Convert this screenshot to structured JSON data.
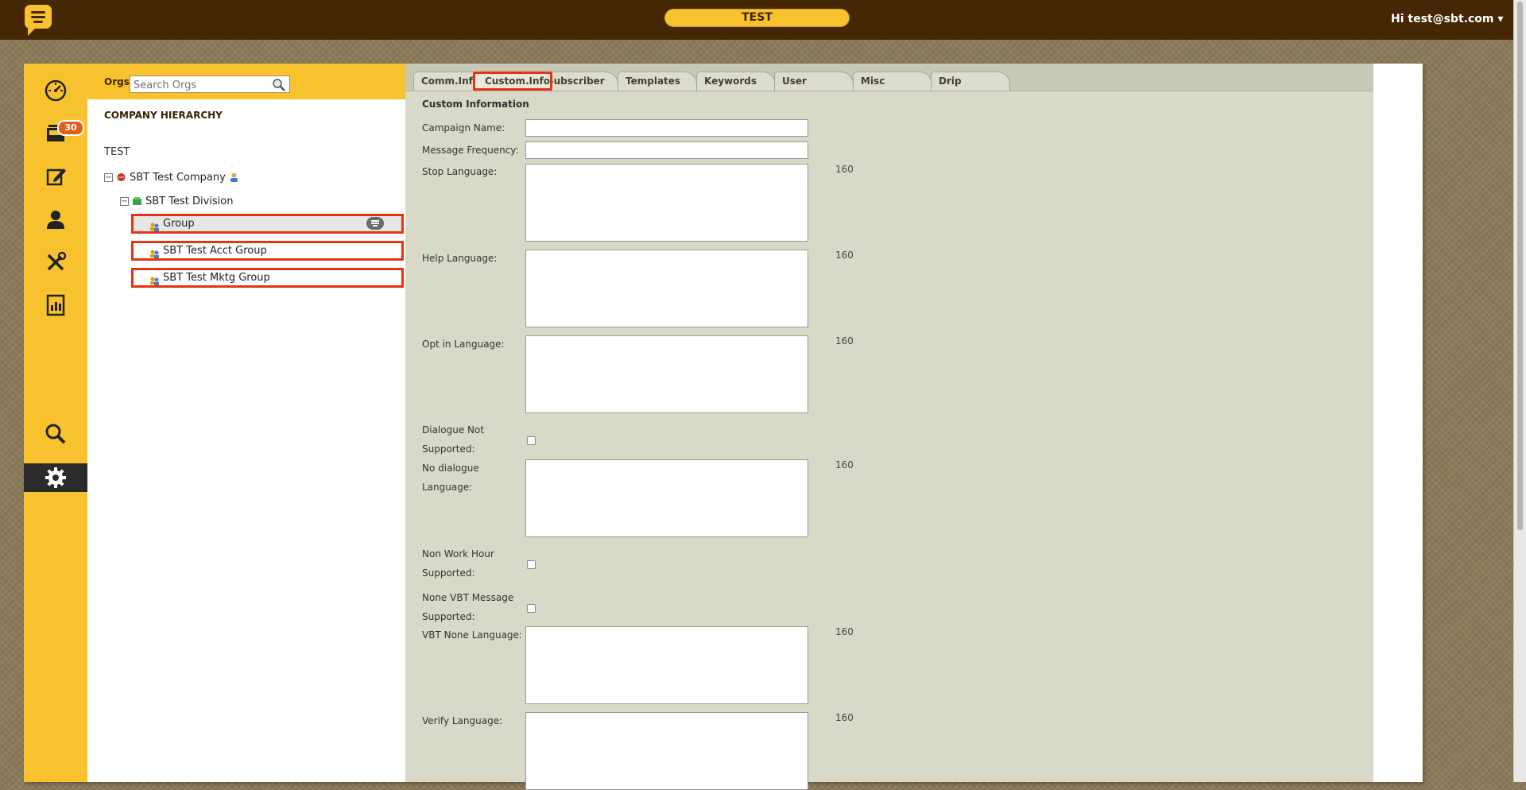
{
  "header": {
    "org_name": "TEST",
    "user_greeting": "Hi test@sbt.com ▾"
  },
  "nav": {
    "items": [
      "dashboard-icon",
      "inbox-icon",
      "compose-icon",
      "contacts-icon",
      "tools-icon",
      "reports-icon",
      "search-icon",
      "settings-icon"
    ],
    "inbox_badge": "30",
    "active_item": "settings-icon"
  },
  "tree": {
    "orgs_label": "Orgs",
    "search_placeholder": "Search Orgs",
    "section_title": "COMPANY HIERARCHY",
    "root": "TEST",
    "company": "SBT Test Company",
    "division": "SBT Test Division",
    "groups": [
      "Group",
      "SBT Test Acct Group",
      "SBT Test Mktg Group"
    ],
    "toggle_symbol": "−"
  },
  "tabs": [
    "Comm.Info",
    "Custom.Info",
    "Subscriber",
    "Templates",
    "Keywords",
    "User",
    "Misc",
    "Drip"
  ],
  "active_tab": "Custom.Info",
  "form": {
    "title": "Custom Information",
    "campaign_name": {
      "label": "Campaign Name:",
      "value": ""
    },
    "message_frequency": {
      "label": "Message Frequency:",
      "value": ""
    },
    "stop_language": {
      "label": "Stop Language:",
      "limit": "160"
    },
    "help_language": {
      "label": "Help Language:",
      "limit": "160"
    },
    "opt_in_language": {
      "label": "Opt in Language:",
      "limit": "160"
    },
    "dialogue_not_supported": {
      "label_line1": "Dialogue Not",
      "label_line2": "Supported:",
      "checked": false
    },
    "no_dialogue_language": {
      "label_line1": "No dialogue",
      "label_line2": "Language:",
      "limit": "160"
    },
    "non_work_hour_supported": {
      "label_line1": "Non Work Hour",
      "label_line2": "Supported:",
      "checked": false
    },
    "none_vbt_message_supported": {
      "label_line1": "None VBT Message",
      "label_line2": "Supported:",
      "checked": false
    },
    "vbt_none_language": {
      "label": "VBT None Language:",
      "limit": "160"
    },
    "verify_language": {
      "label": "Verify Language:",
      "limit": "160"
    }
  },
  "colors": {
    "header_brown": "#452705",
    "accent_yellow": "#f8c22e",
    "highlight_red": "#e63312",
    "panel_gray": "#d9d9c9"
  }
}
